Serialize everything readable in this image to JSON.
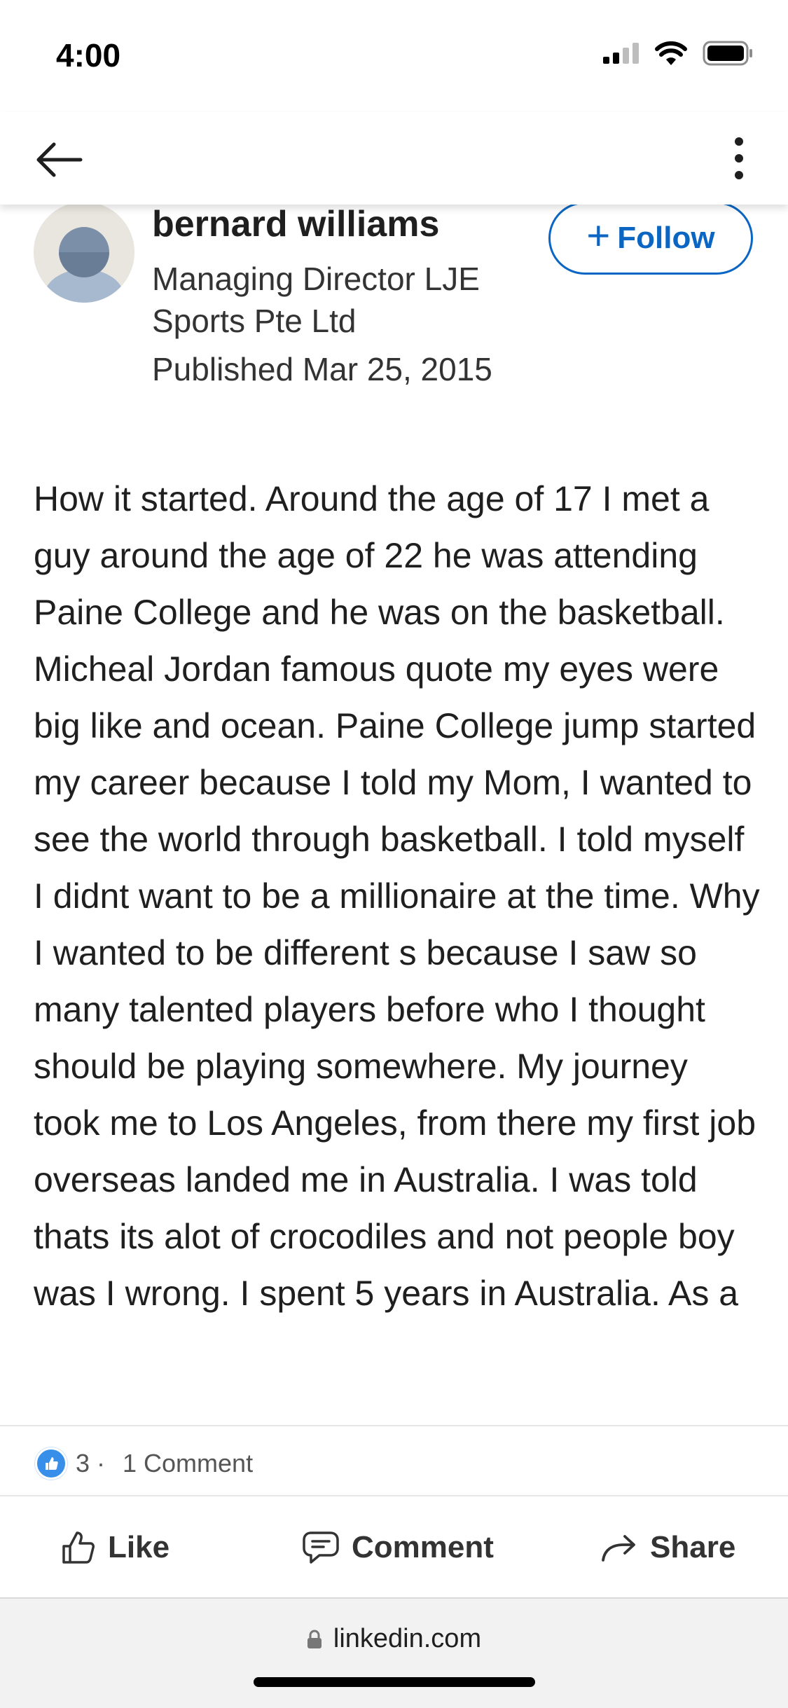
{
  "status_bar": {
    "time": "4:00"
  },
  "author": {
    "name": "bernard williams",
    "title": "Managing Director LJE Sports Pte Ltd",
    "published": "Published Mar 25, 2015",
    "follow_label": "Follow",
    "follow_plus": "+"
  },
  "article": {
    "body": "How it started. Around the age of 17 I met a guy around the age of 22 he was attending Paine College and he was on the basketball. Micheal Jordan famous quote my eyes were big like and ocean. Paine College jump started my career because I told my Mom, I wanted to see the world through basketball. I told myself I didnt want to be a millionaire at the time. Why I wanted to be different s because I saw so many talented players before who I thought should be playing somewhere. My journey took me to Los Angeles, from there my first job overseas landed me in Australia. I was told thats its alot of crocodiles and not people boy was I wrong. I spent 5 years in Australia. As a"
  },
  "social": {
    "reaction_count": "3 ·",
    "comment_count": "1 Comment"
  },
  "actions": {
    "like": "Like",
    "comment": "Comment",
    "share": "Share"
  },
  "browser": {
    "url": "linkedin.com"
  },
  "colors": {
    "accent": "#0a66c2",
    "like_badge": "#378fe9"
  },
  "icons": [
    "back-arrow-icon",
    "more-vertical-icon",
    "signal-icon",
    "wifi-icon",
    "battery-icon",
    "thumbs-up-icon",
    "comment-icon",
    "share-icon",
    "lock-icon"
  ]
}
